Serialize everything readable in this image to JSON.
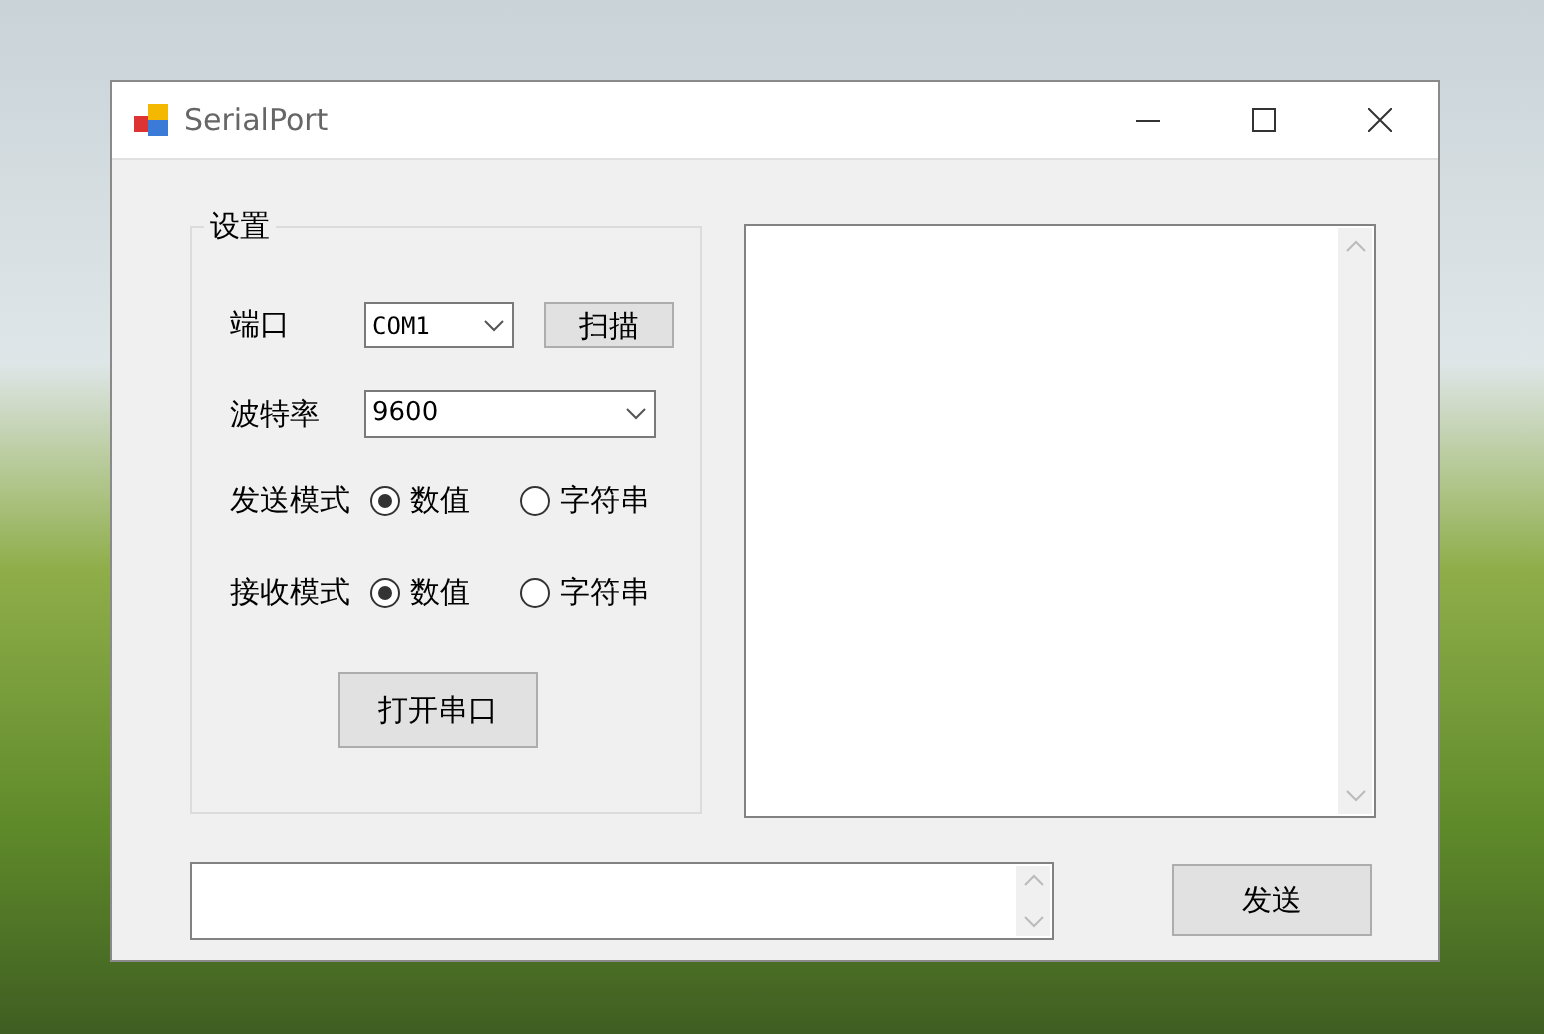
{
  "window": {
    "title": "SerialPort"
  },
  "settings": {
    "title": "设置",
    "port": {
      "label": "端口",
      "value": "COM1"
    },
    "scan_button": "扫描",
    "baud": {
      "label": "波特率",
      "value": "9600"
    },
    "send_mode": {
      "label": "发送模式",
      "options": [
        {
          "label": "数值",
          "selected": true
        },
        {
          "label": "字符串",
          "selected": false
        }
      ]
    },
    "receive_mode": {
      "label": "接收模式",
      "options": [
        {
          "label": "数值",
          "selected": true
        },
        {
          "label": "字符串",
          "selected": false
        }
      ]
    },
    "open_button": "打开串口"
  },
  "send_button": "发送"
}
